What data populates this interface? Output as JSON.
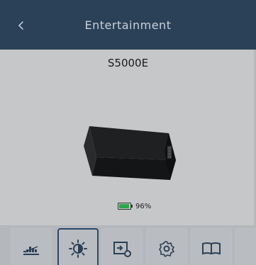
{
  "header": {
    "title": "Entertainment",
    "back_icon": "chevron-left-icon"
  },
  "device": {
    "name": "S5000E",
    "battery_percent": 96,
    "battery_label": "96%"
  },
  "toolbar": {
    "items": [
      {
        "icon": "equalizer-icon",
        "active": false
      },
      {
        "icon": "brightness-icon",
        "active": true
      },
      {
        "icon": "input-settings-icon",
        "active": false
      },
      {
        "icon": "gear-icon",
        "active": false
      },
      {
        "icon": "book-icon",
        "active": false
      },
      {
        "icon": "partial-icon",
        "active": false
      }
    ]
  },
  "colors": {
    "header": "#2b4157",
    "active_border": "#2b4a6a",
    "battery": "#2aa84a"
  }
}
